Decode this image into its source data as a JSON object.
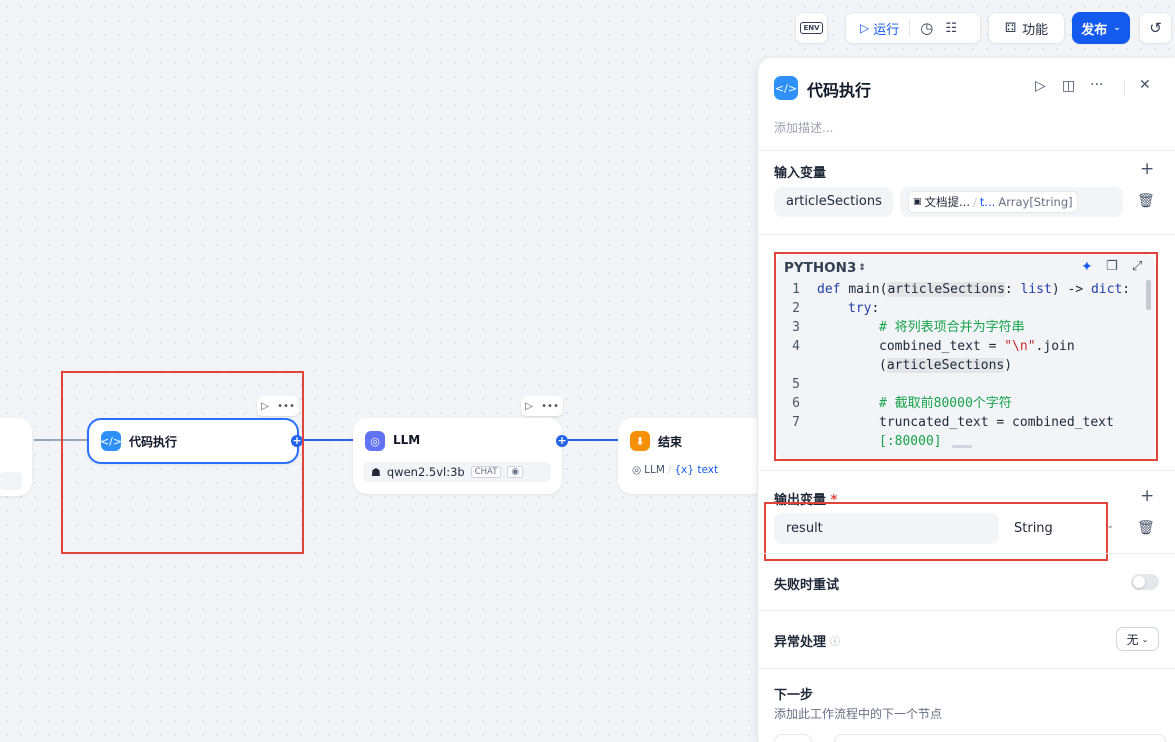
{
  "toolbar": {
    "env_label": "ENV",
    "run_label": "运行",
    "features_label": "功能",
    "publish_label": "发布"
  },
  "canvas": {
    "code_node": {
      "title": "代码执行"
    },
    "llm_node": {
      "title": "LLM",
      "model": "qwen2.5vl:3b",
      "mode_badge": "CHAT"
    },
    "end_node": {
      "title": "结束",
      "var_source": "LLM",
      "var_name": "{x} text"
    }
  },
  "panel": {
    "title": "代码执行",
    "description_placeholder": "添加描述...",
    "inputs": {
      "title": "输入变量",
      "rows": [
        {
          "name": "articleSections",
          "source_node": "文档提...",
          "source_var": "t...",
          "type": "Array[String]"
        }
      ]
    },
    "code": {
      "language": "PYTHON3",
      "lines": [
        {
          "no": "1",
          "parts": [
            {
              "t": "def ",
              "c": "kw"
            },
            {
              "t": "main(",
              "c": ""
            },
            {
              "t": "articleSections",
              "c": "hl"
            },
            {
              "t": ": ",
              "c": ""
            },
            {
              "t": "list",
              "c": "kw"
            },
            {
              "t": ") -> ",
              "c": ""
            },
            {
              "t": "dict",
              "c": "kw"
            },
            {
              "t": ":",
              "c": ""
            }
          ],
          "indent": 0
        },
        {
          "no": "2",
          "parts": [
            {
              "t": "try",
              "c": "kw"
            },
            {
              "t": ":",
              "c": ""
            }
          ],
          "indent": 1
        },
        {
          "no": "3",
          "parts": [
            {
              "t": "# 将列表项合并为字符串",
              "c": "cm"
            }
          ],
          "indent": 2
        },
        {
          "no": "4",
          "parts": [
            {
              "t": "combined_text = ",
              "c": ""
            },
            {
              "t": "\"\\n\"",
              "c": "st"
            },
            {
              "t": ".join",
              "c": ""
            }
          ],
          "indent": 2
        },
        {
          "no": "",
          "parts": [
            {
              "t": "(",
              "c": ""
            },
            {
              "t": "articleSections",
              "c": "hl"
            },
            {
              "t": ")",
              "c": ""
            }
          ],
          "indent": 2
        },
        {
          "no": "5",
          "parts": [],
          "indent": 0
        },
        {
          "no": "6",
          "parts": [
            {
              "t": "# 截取前80000个字符",
              "c": "cm"
            }
          ],
          "indent": 2
        },
        {
          "no": "7",
          "parts": [
            {
              "t": "truncated_text = combined_text",
              "c": ""
            }
          ],
          "indent": 2
        },
        {
          "no": "",
          "parts": [
            {
              "t": "[:80000]",
              "c": "cm"
            }
          ],
          "indent": 2
        }
      ]
    },
    "outputs": {
      "title": "输出变量",
      "required_mark": "*",
      "rows": [
        {
          "name": "result",
          "type": "String"
        }
      ]
    },
    "retry": {
      "title": "失败时重试"
    },
    "error_handling": {
      "title": "异常处理",
      "value": "无"
    },
    "next_step": {
      "title": "下一步",
      "description": "添加此工作流程中的下一个节点"
    }
  },
  "colors": {
    "accent": "#155aef",
    "highlight_box": "#e0443a",
    "code_node_icon": "#2e90fa",
    "llm_node_icon": "#6172f3",
    "end_node_icon": "#f79009"
  }
}
